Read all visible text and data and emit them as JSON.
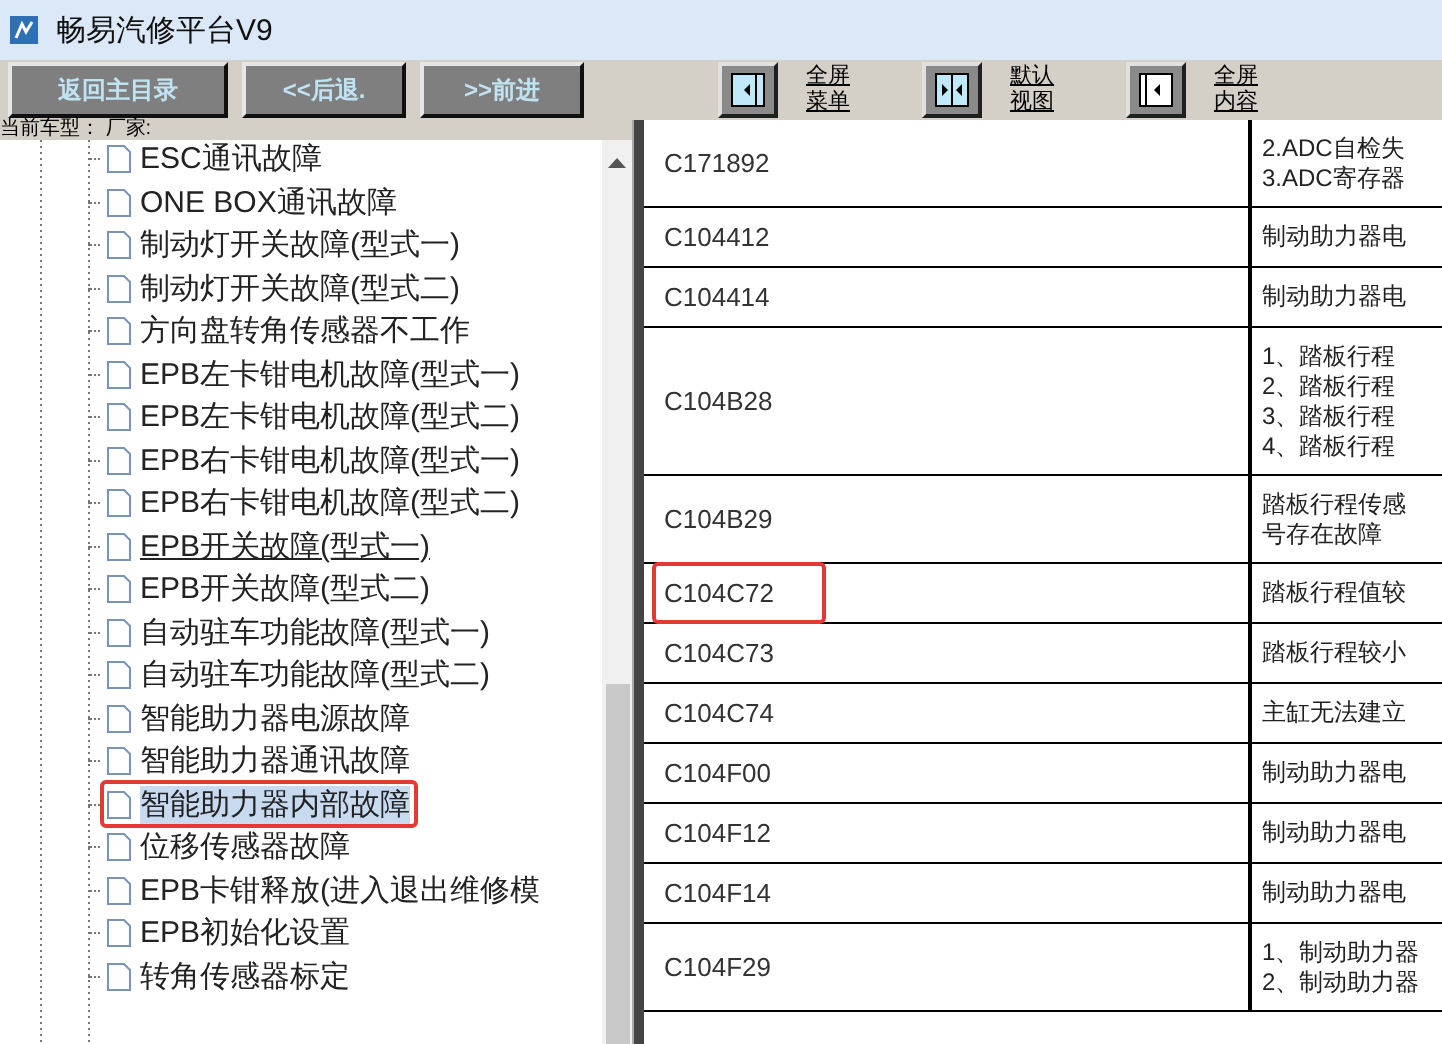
{
  "window": {
    "title": "畅易汽修平台V9"
  },
  "nav_buttons": [
    "返回主目录",
    "<<后退.",
    ">>前进"
  ],
  "view_buttons": [
    {
      "kind": "menu",
      "lines": [
        "全屏",
        "菜单"
      ]
    },
    {
      "kind": "default",
      "lines": [
        "默认",
        "视图"
      ]
    },
    {
      "kind": "content",
      "lines": [
        "全屏",
        "内容"
      ]
    }
  ],
  "vehicle_label": "当前车型： 厂家:",
  "tree": {
    "items": [
      {
        "label": "ESC通讯故障",
        "selected": false,
        "hovered": false,
        "outlined": false
      },
      {
        "label": "ONE BOX通讯故障",
        "selected": false,
        "hovered": false,
        "outlined": false
      },
      {
        "label": "制动灯开关故障(型式一)",
        "selected": false,
        "hovered": false,
        "outlined": false
      },
      {
        "label": "制动灯开关故障(型式二)",
        "selected": false,
        "hovered": false,
        "outlined": false
      },
      {
        "label": "方向盘转角传感器不工作",
        "selected": false,
        "hovered": false,
        "outlined": false
      },
      {
        "label": "EPB左卡钳电机故障(型式一)",
        "selected": false,
        "hovered": false,
        "outlined": false
      },
      {
        "label": "EPB左卡钳电机故障(型式二)",
        "selected": false,
        "hovered": false,
        "outlined": false
      },
      {
        "label": "EPB右卡钳电机故障(型式一)",
        "selected": false,
        "hovered": false,
        "outlined": false
      },
      {
        "label": "EPB右卡钳电机故障(型式二)",
        "selected": false,
        "hovered": false,
        "outlined": false
      },
      {
        "label": "EPB开关故障(型式一)",
        "selected": false,
        "hovered": true,
        "outlined": false
      },
      {
        "label": "EPB开关故障(型式二)",
        "selected": false,
        "hovered": false,
        "outlined": false
      },
      {
        "label": "自动驻车功能故障(型式一)",
        "selected": false,
        "hovered": false,
        "outlined": false
      },
      {
        "label": "自动驻车功能故障(型式二)",
        "selected": false,
        "hovered": false,
        "outlined": false
      },
      {
        "label": "智能助力器电源故障",
        "selected": false,
        "hovered": false,
        "outlined": false
      },
      {
        "label": "智能助力器通讯故障",
        "selected": false,
        "hovered": false,
        "outlined": false
      },
      {
        "label": "智能助力器内部故障",
        "selected": true,
        "hovered": false,
        "outlined": true
      },
      {
        "label": "位移传感器故障",
        "selected": false,
        "hovered": false,
        "outlined": false
      },
      {
        "label": "EPB卡钳释放(进入退出维修模",
        "selected": false,
        "hovered": false,
        "outlined": false
      },
      {
        "label": "EPB初始化设置",
        "selected": false,
        "hovered": false,
        "outlined": false
      },
      {
        "label": "转角传感器标定",
        "selected": false,
        "hovered": false,
        "outlined": false
      }
    ]
  },
  "table": {
    "rows": [
      {
        "code": "C171892",
        "description": [
          "2.ADC自检失",
          "3.ADC寄存器"
        ],
        "outlined": false
      },
      {
        "code": "C104412",
        "description": [
          "制动助力器电"
        ],
        "outlined": false
      },
      {
        "code": "C104414",
        "description": [
          "制动助力器电"
        ],
        "outlined": false
      },
      {
        "code": "C104B28",
        "description": [
          "1、踏板行程",
          "2、踏板行程",
          "3、踏板行程",
          "4、踏板行程"
        ],
        "outlined": false
      },
      {
        "code": "C104B29",
        "description": [
          "踏板行程传感",
          "号存在故障"
        ],
        "outlined": false
      },
      {
        "code": "C104C72",
        "description": [
          "踏板行程值较"
        ],
        "outlined": true
      },
      {
        "code": "C104C73",
        "description": [
          "踏板行程较小"
        ],
        "outlined": false
      },
      {
        "code": "C104C74",
        "description": [
          "主缸无法建立"
        ],
        "outlined": false
      },
      {
        "code": "C104F00",
        "description": [
          "制动助力器电"
        ],
        "outlined": false
      },
      {
        "code": "C104F12",
        "description": [
          "制动助力器电"
        ],
        "outlined": false
      },
      {
        "code": "C104F14",
        "description": [
          "制动助力器电"
        ],
        "outlined": false
      },
      {
        "code": "C104F29",
        "description": [
          "1、制动助力器",
          "2、制动助力器"
        ],
        "outlined": false
      }
    ]
  }
}
